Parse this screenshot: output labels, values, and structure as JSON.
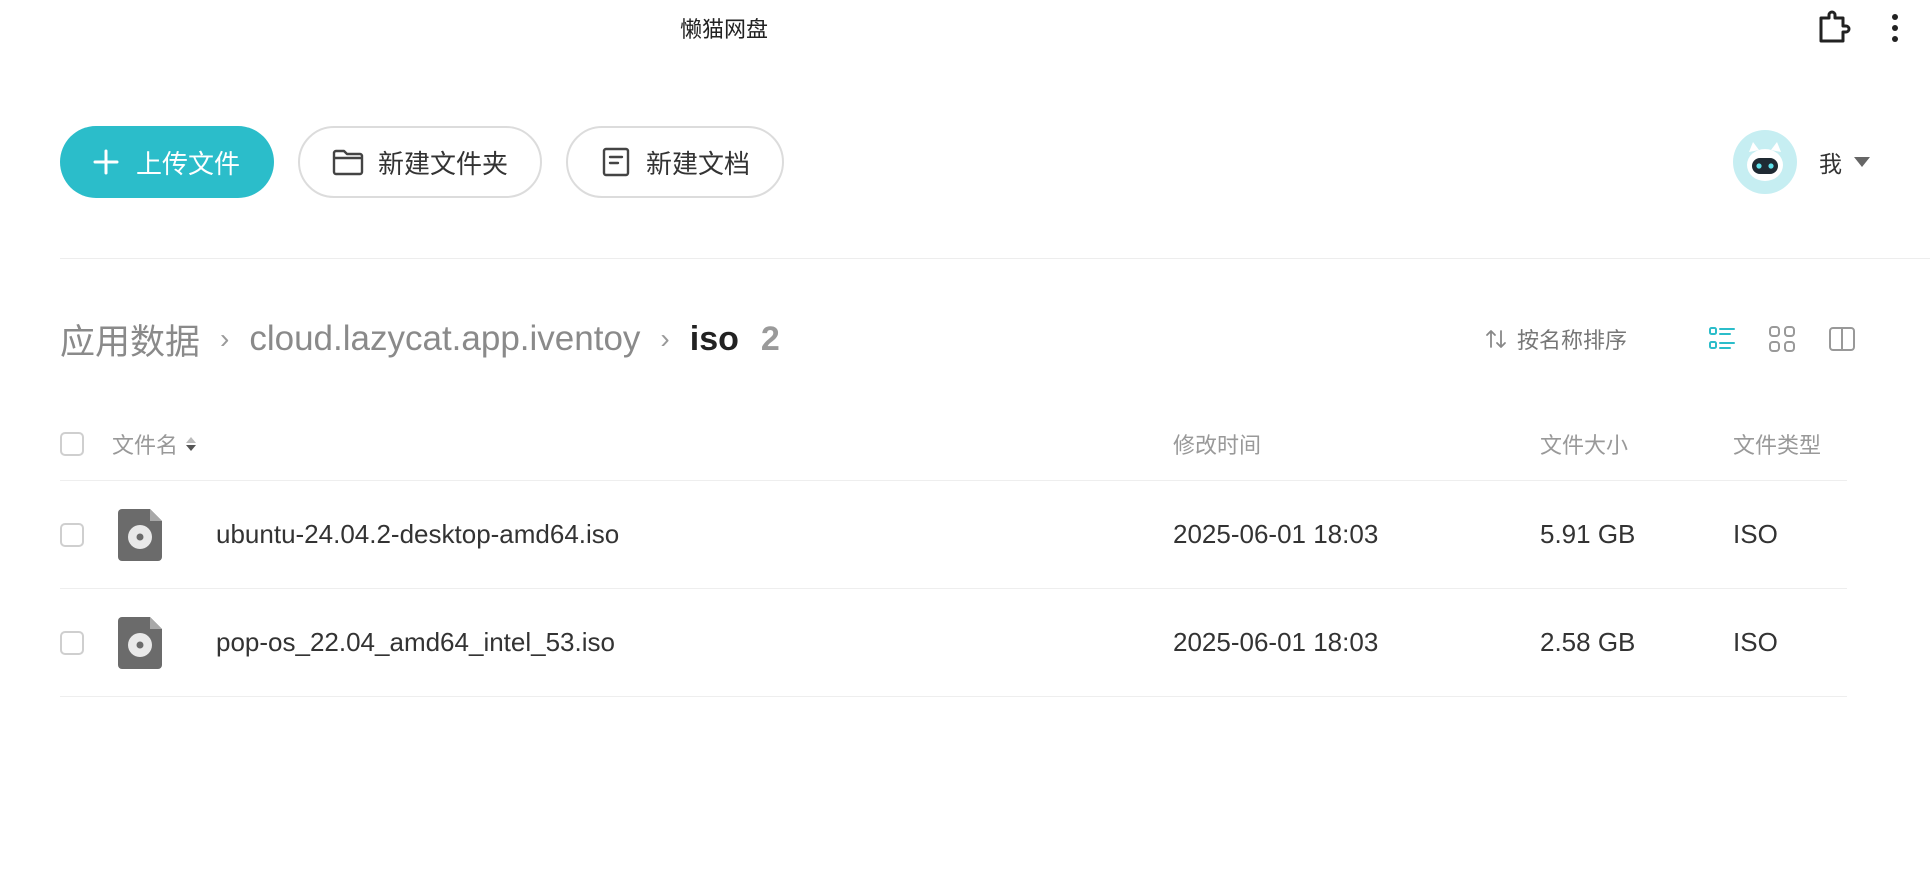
{
  "window": {
    "title": "懒猫网盘"
  },
  "toolbar": {
    "upload_label": "上传文件",
    "new_folder_label": "新建文件夹",
    "new_doc_label": "新建文档"
  },
  "user": {
    "name": "我"
  },
  "breadcrumb": {
    "items": [
      "应用数据",
      "cloud.lazycat.app.iventoy"
    ],
    "separator": "›",
    "current": "iso",
    "count": "2"
  },
  "sort": {
    "label": "按名称排序"
  },
  "view_modes": [
    "list-view-icon",
    "grid-view-icon",
    "split-view-icon"
  ],
  "table": {
    "headers": {
      "name": "文件名",
      "modified": "修改时间",
      "size": "文件大小",
      "type": "文件类型"
    },
    "rows": [
      {
        "name": "ubuntu-24.04.2-desktop-amd64.iso",
        "modified": "2025-06-01 18:03",
        "size": "5.91 GB",
        "type": "ISO",
        "icon": "disc-image-file-icon"
      },
      {
        "name": "pop-os_22.04_amd64_intel_53.iso",
        "modified": "2025-06-01 18:03",
        "size": "2.58 GB",
        "type": "ISO",
        "icon": "disc-image-file-icon"
      }
    ]
  },
  "colors": {
    "accent": "#2bbdca",
    "active_view": "#2bbdca"
  }
}
